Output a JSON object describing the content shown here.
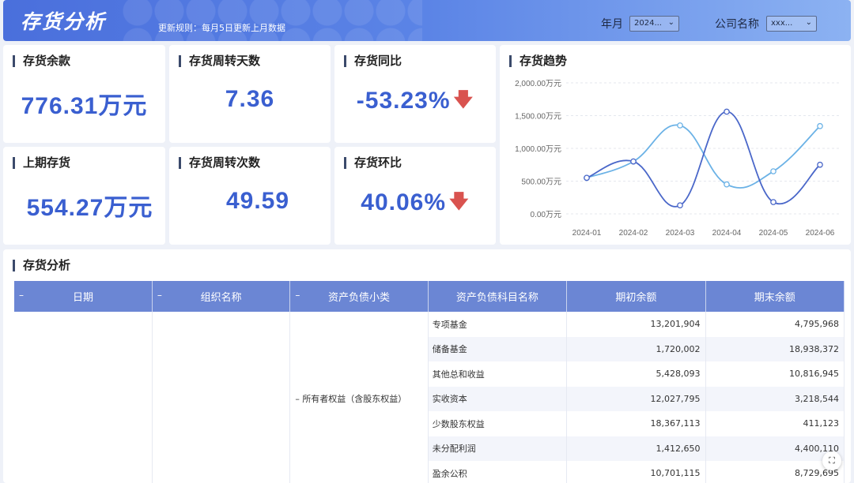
{
  "header": {
    "title": "存货分析",
    "update_rule": "更新规则：每月5日更新上月数据",
    "filters": [
      {
        "label": "年月",
        "value": "2024..."
      },
      {
        "label": "公司名称",
        "value": "xxx..."
      }
    ]
  },
  "kpis": [
    {
      "title": "存货余款",
      "value": "776.31万元"
    },
    {
      "title": "存货周转天数",
      "value": "7.36"
    },
    {
      "title": "存货同比",
      "value": "-53.23%",
      "trend": "down"
    },
    {
      "title": "上期存货",
      "value": "554.27万元"
    },
    {
      "title": "存货周转次数",
      "value": "49.59"
    },
    {
      "title": "存货环比",
      "value": "40.06%",
      "trend": "down"
    }
  ],
  "chart_title": "存货趋势",
  "chart_data": {
    "type": "line",
    "categories": [
      "2024-01",
      "2024-02",
      "2024-03",
      "2024-04",
      "2024-05",
      "2024-06"
    ],
    "y_ticks": [
      "0.00万元",
      "500.00万元",
      "1,000.00万元",
      "1,500.00万元",
      "2,000.00万元"
    ],
    "ylim": [
      0,
      2000
    ],
    "grid": true,
    "smooth": true,
    "series": [
      {
        "values": [
          550,
          800,
          1350,
          450,
          650,
          1340
        ],
        "color": "#6bb2e6"
      },
      {
        "values": [
          550,
          800,
          130,
          1560,
          180,
          750
        ],
        "color": "#4a67c9"
      }
    ]
  },
  "table": {
    "title": "存货分析",
    "columns": [
      "日期",
      "组织名称",
      "资产负债小类",
      "资产负债科目名称",
      "期初余额",
      "期末余额"
    ],
    "collapsible": [
      true,
      true,
      true,
      false,
      false,
      false
    ],
    "group_label": "所有者权益（含股东权益）",
    "rows": [
      {
        "name": "专项基金",
        "opening": "13,201,904",
        "closing": "4,795,968"
      },
      {
        "name": "储备基金",
        "opening": "1,720,002",
        "closing": "18,938,372"
      },
      {
        "name": "其他总和收益",
        "opening": "5,428,093",
        "closing": "10,816,945"
      },
      {
        "name": "实收资本",
        "opening": "12,027,795",
        "closing": "3,218,544"
      },
      {
        "name": "少数股东权益",
        "opening": "18,367,113",
        "closing": "411,123"
      },
      {
        "name": "未分配利润",
        "opening": "1,412,650",
        "closing": "4,400,110"
      },
      {
        "name": "盈余公积",
        "opening": "10,701,115",
        "closing": "8,729,695"
      }
    ]
  }
}
